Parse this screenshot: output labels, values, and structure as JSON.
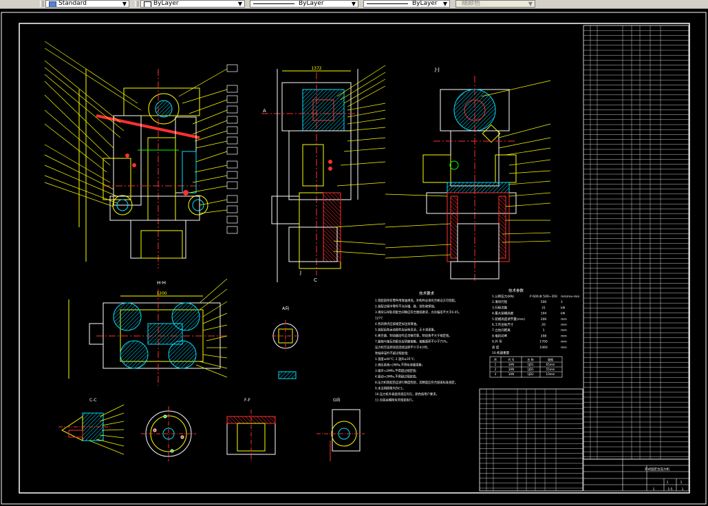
{
  "toolbar": {
    "text_style": "Standard",
    "layer_color": "ByLayer",
    "linetype": "ByLayer",
    "lineweight": "ByLayer",
    "plot_style": "随颜色"
  },
  "views": {
    "section_jj": "J-J",
    "section_hh": "H-H",
    "section_cc": "C-C",
    "section_ff": "F-F",
    "view_g": "G向",
    "view_a": "A向",
    "section_a": "A",
    "section_c": "C",
    "section_j": "J"
  },
  "dimensions": {
    "front_width": "1372",
    "plan_width": "1200"
  },
  "tech_spec": {
    "title": "技术参数",
    "params": [
      {
        "n": "1.公称压力(KN)",
        "v": "P 600,Φ 500~350",
        "u": "mm/rev·min"
      },
      {
        "n": "2.滑块行程",
        "v": "500",
        "u": "1"
      },
      {
        "n": "3.行程次数",
        "v": "31",
        "u": "kN"
      },
      {
        "n": "4.最大装模高度",
        "v": "104",
        "u": "kN"
      },
      {
        "n": "5.装模高度调节量(mm)",
        "v": "200",
        "u": "mm"
      },
      {
        "n": "6.工作台板尺寸",
        "v": "20",
        "u": "mm"
      },
      {
        "n": "7.立柱间距离",
        "v": "1",
        "u": "mm"
      },
      {
        "n": "8.电机功率",
        "v": "208",
        "u": "mm"
      },
      {
        "n": "9.外  形",
        "v": "1700",
        "u": "mm"
      },
      {
        "n": "    高  度",
        "v": "1060",
        "u": "mm"
      },
      {
        "n": "10.机器重量",
        "v": "",
        "u": ""
      }
    ]
  },
  "tech_req": {
    "title": "技术要求",
    "lines": [
      "1.装配前所有零件用煤油清洗，外购件必须有合格证方可装配。",
      "2.装配过程中零件不允许磕、碰、划伤和锈蚀。",
      "3.滑块与导轨的配合间隙应符合图纸要求，允许偏差不大于0.05。",
      "  1277.",
      "4.各润滑点应按规定加注润滑油。",
      "5.装配后各运动部件应运转灵活，无卡滞现象。",
      "6.离合器、制动器动作应灵敏可靠，制动角不大于规定值。",
      "7.曲轴与轴瓦的配合应研磨接触，接触面积不小于75%。",
      "  压力机空运转试验连续运转不少于4小时。",
      "  各轴承温升不超过规定值:",
      "  1.温度≤40°C;  2.温升≤35°C;",
      "  2.液压系统≈2MPa,不得有渗漏现象;",
      "  3.噪声≈2MPa,不得超过规定值;",
      "  4.振动≈2MPa,不得超过规定值。",
      "8.压力机装配后应进行精度检验，其精度应符合国家标准规定。",
      "9.未注明倒角均为C1。",
      "10.压力机外表面涂漆应均匀，颜色按用户要求。",
      "11.包装运输按有关规定执行。"
    ]
  },
  "small_table": {
    "head": [
      "序",
      "代 号",
      "名 称",
      "规格"
    ],
    "rows": [
      [
        "1",
        "3AN",
        "1JD1",
        "65mm"
      ],
      [
        "2",
        "3AN",
        "1JD1",
        "55mm"
      ],
      [
        "3",
        "3AN",
        "1JD2",
        "10mm"
      ]
    ]
  },
  "title_block": {
    "drawing_name": "开式固定台压力机",
    "sheet": "1",
    "scale": "1:5",
    "qty": "1",
    "sheets": "1",
    "total": "1"
  }
}
